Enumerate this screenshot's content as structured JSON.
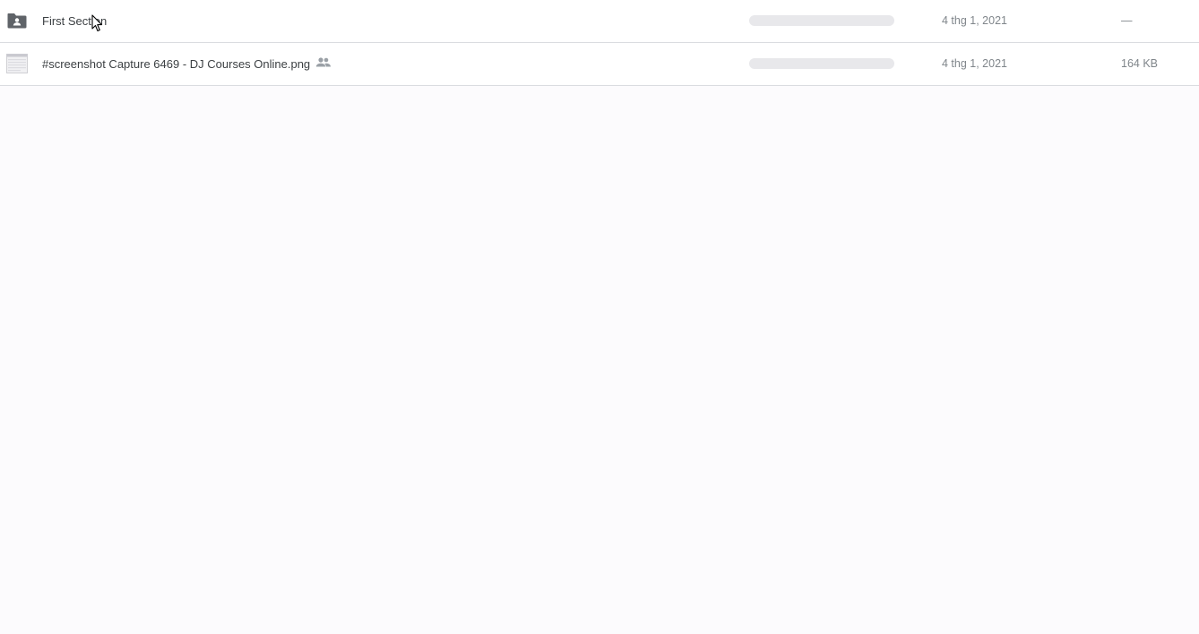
{
  "files": [
    {
      "name": "First Section",
      "icon": "shared-folder-icon",
      "modified": "4 thg 1, 2021",
      "size": "—"
    },
    {
      "name": "#screenshot Capture 6469 - DJ Courses Online.png",
      "icon": "image-thumbnail-icon",
      "shared_icon": "people-icon",
      "modified": "4 thg 1, 2021",
      "size": "164 KB"
    }
  ],
  "colors": {
    "icon": "#5f6368",
    "text": "#3c4043",
    "muted": "#80868b",
    "divider": "#dadce0",
    "placeholder": "#e8e8eb"
  }
}
